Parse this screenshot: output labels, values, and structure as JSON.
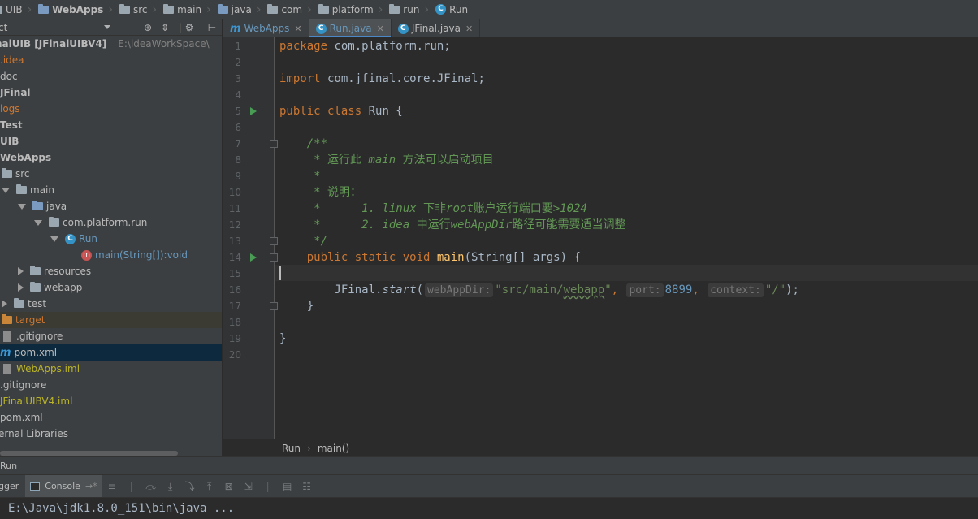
{
  "breadcrumb": {
    "items": [
      {
        "label": "UIB",
        "icon": "folder-icon"
      },
      {
        "label": "WebApps",
        "icon": "module-folder-icon"
      },
      {
        "label": "src",
        "icon": "folder-icon"
      },
      {
        "label": "main",
        "icon": "folder-icon"
      },
      {
        "label": "java",
        "icon": "folder-icon"
      },
      {
        "label": "com",
        "icon": "folder-icon"
      },
      {
        "label": "platform",
        "icon": "folder-icon"
      },
      {
        "label": "run",
        "icon": "folder-icon"
      },
      {
        "label": "Run",
        "icon": "class-icon"
      }
    ]
  },
  "project_panel": {
    "view_selector": "ct",
    "root_label": "nalUIB [JFinalUIBV4]",
    "root_path": "E:\\ideaWorkSpace\\",
    "tree": [
      {
        "label": ".idea",
        "color": "#cc7832"
      },
      {
        "label": "doc"
      },
      {
        "label": "JFinal"
      },
      {
        "label": "logs",
        "color": "#cc7832"
      },
      {
        "label": "Test"
      },
      {
        "label": "UIB"
      },
      {
        "label": "WebApps"
      },
      {
        "label": "src"
      },
      {
        "label": "main"
      },
      {
        "label": "java"
      },
      {
        "label": "com.platform.run"
      },
      {
        "label": "Run"
      },
      {
        "label": "main(String[]):void"
      },
      {
        "label": "resources"
      },
      {
        "label": "webapp"
      },
      {
        "label": "test"
      },
      {
        "label": "target"
      },
      {
        "label": ".gitignore"
      },
      {
        "label": "pom.xml"
      },
      {
        "label": "WebApps.iml"
      },
      {
        "label": ".gitignore"
      },
      {
        "label": "JFinalUIBV4.iml"
      },
      {
        "label": "pom.xml"
      },
      {
        "label": "ernal Libraries"
      }
    ]
  },
  "tabs": [
    {
      "label": "WebApps",
      "icon": "maven-m-icon",
      "active": false
    },
    {
      "label": "Run.java",
      "icon": "class-icon",
      "active": true
    },
    {
      "label": "JFinal.java",
      "icon": "class-icon",
      "active": false
    }
  ],
  "editor": {
    "line_numbers": [
      "1",
      "2",
      "3",
      "4",
      "5",
      "6",
      "7",
      "8",
      "9",
      "10",
      "11",
      "12",
      "13",
      "14",
      "15",
      "16",
      "17",
      "18",
      "19",
      "20"
    ],
    "code": {
      "l1_kw": "package",
      "l1_rest": " com.platform.run;",
      "l3_kw": "import",
      "l3_rest": " com.jfinal.core.JFinal;",
      "l5_kw": "public class",
      "l5_rest": " Run {",
      "l7": "    /**",
      "l8_a": "     * 运行此 ",
      "l8_b": "main",
      "l8_c": " 方法可以启动项目",
      "l9": "     *",
      "l10": "     * 说明：",
      "l11_a": "     *      1. ",
      "l11_b": "linux",
      "l11_c": " 下非",
      "l11_d": "root",
      "l11_e": "账户运行端口要",
      "l11_f": ">1024",
      "l12_a": "     *      2. ",
      "l12_b": "idea",
      "l12_c": " 中运行",
      "l12_d": "webAppDir",
      "l12_e": "路径可能需要适当调整",
      "l13": "     */",
      "l14_kw": "    public static void ",
      "l14_fn": "main",
      "l14_rest": "(String[] args) {",
      "l16_a": "        JFinal.",
      "l16_fn": "start",
      "l16_p": "(",
      "l16_hint1": "webAppDir:",
      "l16_str1a": "\"src/main/",
      "l16_str1b": "webapp",
      "l16_str1c": "\"",
      "l16_c1": ", ",
      "l16_hint2": "port:",
      "l16_num": "8899",
      "l16_c2": ", ",
      "l16_hint3": "context:",
      "l16_str2": "\"/\"",
      "l16_end": ");",
      "l17": "    }",
      "l19": "}"
    },
    "breadcrumbs": [
      "Run",
      "main()"
    ]
  },
  "run_window": {
    "title": "Run",
    "tabs": {
      "debugger": "gger",
      "console": "Console"
    },
    "console_line": "E:\\Java\\jdk1.8.0_151\\bin\\java ..."
  }
}
